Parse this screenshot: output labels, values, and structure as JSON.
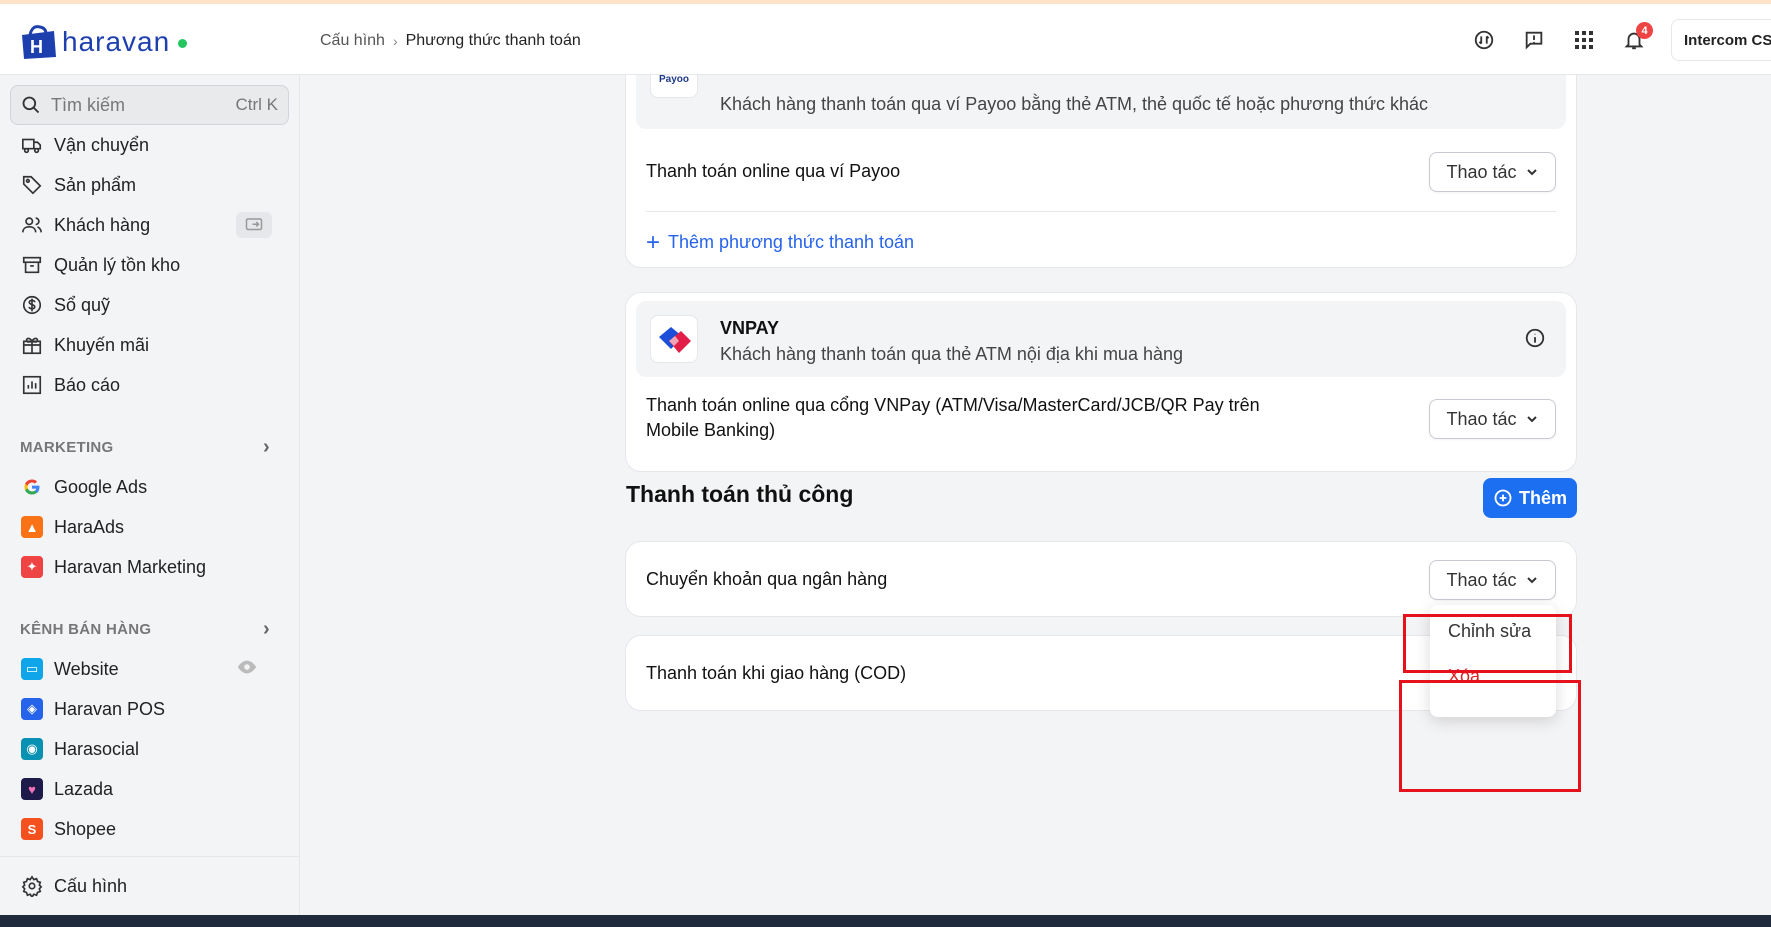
{
  "brand": {
    "name": "haravan",
    "accent": "#1e40af",
    "status_dot": "#22c55e"
  },
  "breadcrumb": {
    "parent": "Cấu hình",
    "current": "Phương thức thanh toán"
  },
  "topbar": {
    "icons": [
      "exchange-icon",
      "feedback-icon",
      "apps-grid-icon",
      "bell-icon"
    ],
    "notification_count": "4",
    "intercom_label": "Intercom CS"
  },
  "sidebar": {
    "search_placeholder": "Tìm kiếm",
    "search_shortcut": "Ctrl K",
    "items": [
      {
        "label": "Vận chuyển",
        "icon": "truck-icon"
      },
      {
        "label": "Sản phẩm",
        "icon": "tag-icon"
      },
      {
        "label": "Khách hàng",
        "icon": "users-icon"
      },
      {
        "label": "Quản lý tồn kho",
        "icon": "archive-icon"
      },
      {
        "label": "Sổ quỹ",
        "icon": "dollar-circle-icon"
      },
      {
        "label": "Khuyến mãi",
        "icon": "gift-icon"
      },
      {
        "label": "Báo cáo",
        "icon": "chart-icon"
      }
    ],
    "marketing_label": "MARKETING",
    "marketing_items": [
      {
        "label": "Google Ads",
        "icon": "google-icon"
      },
      {
        "label": "HaraAds",
        "icon": "haraads-icon"
      },
      {
        "label": "Haravan Marketing",
        "icon": "haravan-marketing-icon"
      }
    ],
    "channels_label": "KÊNH BÁN HÀNG",
    "channel_items": [
      {
        "label": "Website",
        "icon": "website-icon"
      },
      {
        "label": "Haravan POS",
        "icon": "pos-icon"
      },
      {
        "label": "Harasocial",
        "icon": "harasocial-icon"
      },
      {
        "label": "Lazada",
        "icon": "lazada-icon"
      },
      {
        "label": "Shopee",
        "icon": "shopee-icon"
      }
    ],
    "settings_label": "Cấu hình"
  },
  "payoo": {
    "desc": "Khách hàng thanh toán qua ví Payoo bằng thẻ ATM, thẻ quốc tế hoặc phương thức khác",
    "row_label": "Thanh toán online qua ví Payoo",
    "action_label": "Thao tác",
    "add_label": "Thêm phương thức thanh toán"
  },
  "vnpay": {
    "name": "VNPAY",
    "desc": "Khách hàng thanh toán qua thẻ ATM nội địa khi mua hàng",
    "row_label": "Thanh toán online qua cổng VNPay (ATM/Visa/MasterCard/JCB/QR Pay trên Mobile Banking)",
    "action_label": "Thao tác"
  },
  "manual": {
    "title": "Thanh toán thủ công",
    "add_button": "Thêm",
    "methods": [
      {
        "label": "Chuyển khoản qua ngân hàng",
        "action_label": "Thao tác"
      },
      {
        "label": "Thanh toán khi giao hàng (COD)"
      }
    ],
    "dropdown": {
      "edit": "Chỉnh sửa",
      "delete": "Xóa"
    }
  },
  "colors": {
    "link": "#2563eb",
    "primary_button": "#1d6ff2",
    "danger": "#dc2626",
    "highlight": "#e5121b"
  }
}
